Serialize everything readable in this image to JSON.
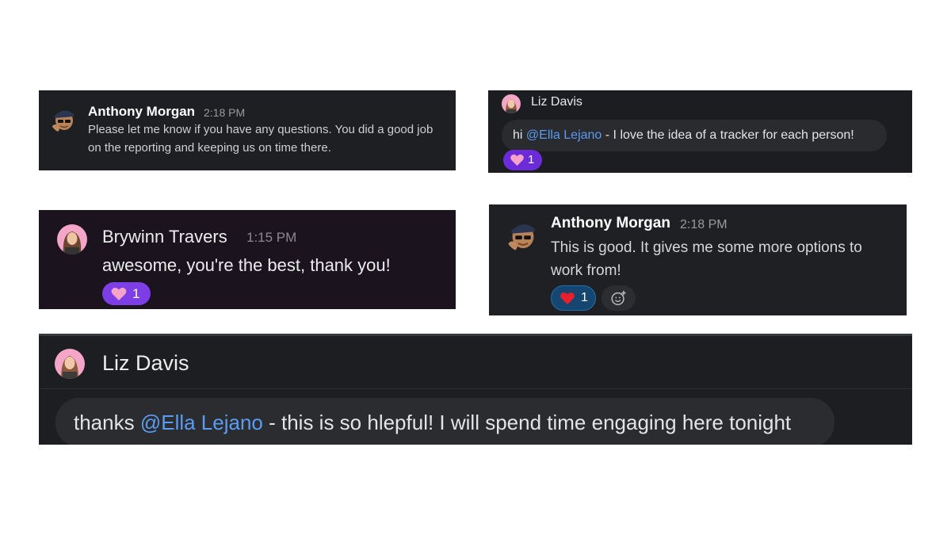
{
  "cards": [
    {
      "author": "Anthony Morgan",
      "time": "2:18 PM",
      "message": "Please let me know if you have any questions. You did a good job on the reporting and keeping us on time there."
    },
    {
      "author": "Liz Davis",
      "message_prefix": "hi ",
      "mention": "@Ella Lejano",
      "message_suffix": " - I love the idea of a tracker for each person!",
      "reaction": {
        "icon": "pink-heart-icon",
        "count": "1"
      }
    },
    {
      "author": "Brywinn Travers",
      "time": "1:15 PM",
      "message": "awesome, you're the best, thank you!",
      "reaction": {
        "icon": "pink-heart-icon",
        "count": "1"
      }
    },
    {
      "author": "Anthony Morgan",
      "time": "2:18 PM",
      "message": "This is good. It gives me some more options to work from!",
      "reaction": {
        "icon": "red-heart-icon",
        "count": "1"
      },
      "add_reaction_icon": "add-reaction-icon"
    },
    {
      "author": "Liz Davis",
      "message_prefix": "thanks ",
      "mention": "@Ella Lejano",
      "message_suffix": " - this is so hlepful! I will spend time engaging here tonight"
    }
  ],
  "colors": {
    "mention": "#5a9cf2",
    "reaction_purple": "#7d3ee6",
    "reaction_blue": "#14466f",
    "heart_red": "#e8202c",
    "heart_pink": "#f6a3c9"
  }
}
